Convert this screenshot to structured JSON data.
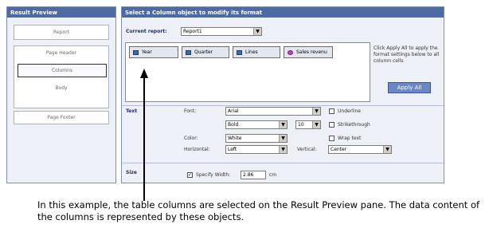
{
  "left": {
    "title": "Result Preview",
    "report": "Report",
    "page_header": "Page Header",
    "columns": "Columns",
    "body": "Body",
    "page_footer": "Page Footer"
  },
  "right": {
    "title": "Select a Column object to modify its format",
    "current_report_label": "Current report:",
    "current_report_value": "Report1",
    "objects": [
      "Year",
      "Quarter",
      "Lines",
      "Sales revenu"
    ],
    "note": "Click Apply All to apply the format settings below to all column cells",
    "apply_all": "Apply All",
    "text_section": "Text",
    "font_label": "Font:",
    "font_value": "Arial",
    "style_value": "Bold",
    "size_value": "10",
    "color_label": "Color:",
    "color_value": "White",
    "horizontal_label": "Horizontal:",
    "horizontal_value": "Left",
    "vertical_label": "Vertical:",
    "vertical_value": "Center",
    "underline": "Underline",
    "strikethrough": "Strikethrough",
    "wrap_text": "Wrap text",
    "size_section": "Size",
    "specify_width": "Specify Width:",
    "width_value": "2.86",
    "width_unit": "cm"
  },
  "caption": "In this example, the table columns are selected on the Result Preview pane. The data content of the columns is represented by these objects."
}
